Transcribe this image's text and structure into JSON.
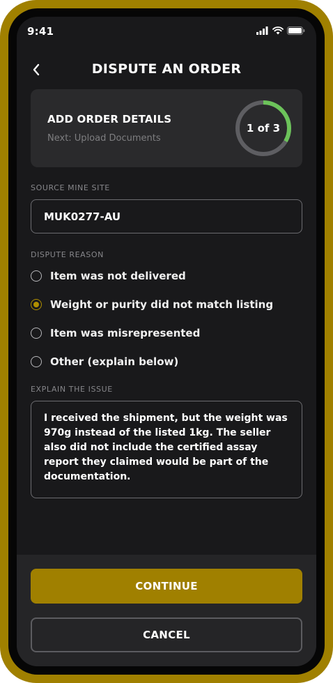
{
  "status_bar": {
    "time": "9:41",
    "icons": [
      "signal-icon",
      "wifi-icon",
      "battery-icon"
    ]
  },
  "header": {
    "back_icon": "chevron-left-icon",
    "title": "DISPUTE AN ORDER"
  },
  "step": {
    "title": "ADD ORDER DETAILS",
    "next": "Next: Upload Documents",
    "progress_label": "1 of 3",
    "current": 1,
    "total": 3
  },
  "source": {
    "label": "SOURCE MINE SITE",
    "value": "MUK0277-AU"
  },
  "reason": {
    "label": "DISPUTE REASON",
    "options": [
      {
        "label": "Item was not delivered",
        "selected": false
      },
      {
        "label": "Weight or purity did not match listing",
        "selected": true
      },
      {
        "label": "Item was misrepresented",
        "selected": false
      },
      {
        "label": "Other (explain below)",
        "selected": false
      }
    ]
  },
  "explain": {
    "label": "EXPLAIN THE ISSUE",
    "value": "I received the shipment, but the weight was 970g instead of the listed 1kg. The seller also did not include the certified assay report they claimed would be part of the documentation."
  },
  "actions": {
    "continue_label": "CONTINUE",
    "cancel_label": "CANCEL"
  },
  "colors": {
    "accent": "#a08000",
    "progress": "#6cc35a",
    "background": "#19191b",
    "card": "#2a2a2c"
  }
}
